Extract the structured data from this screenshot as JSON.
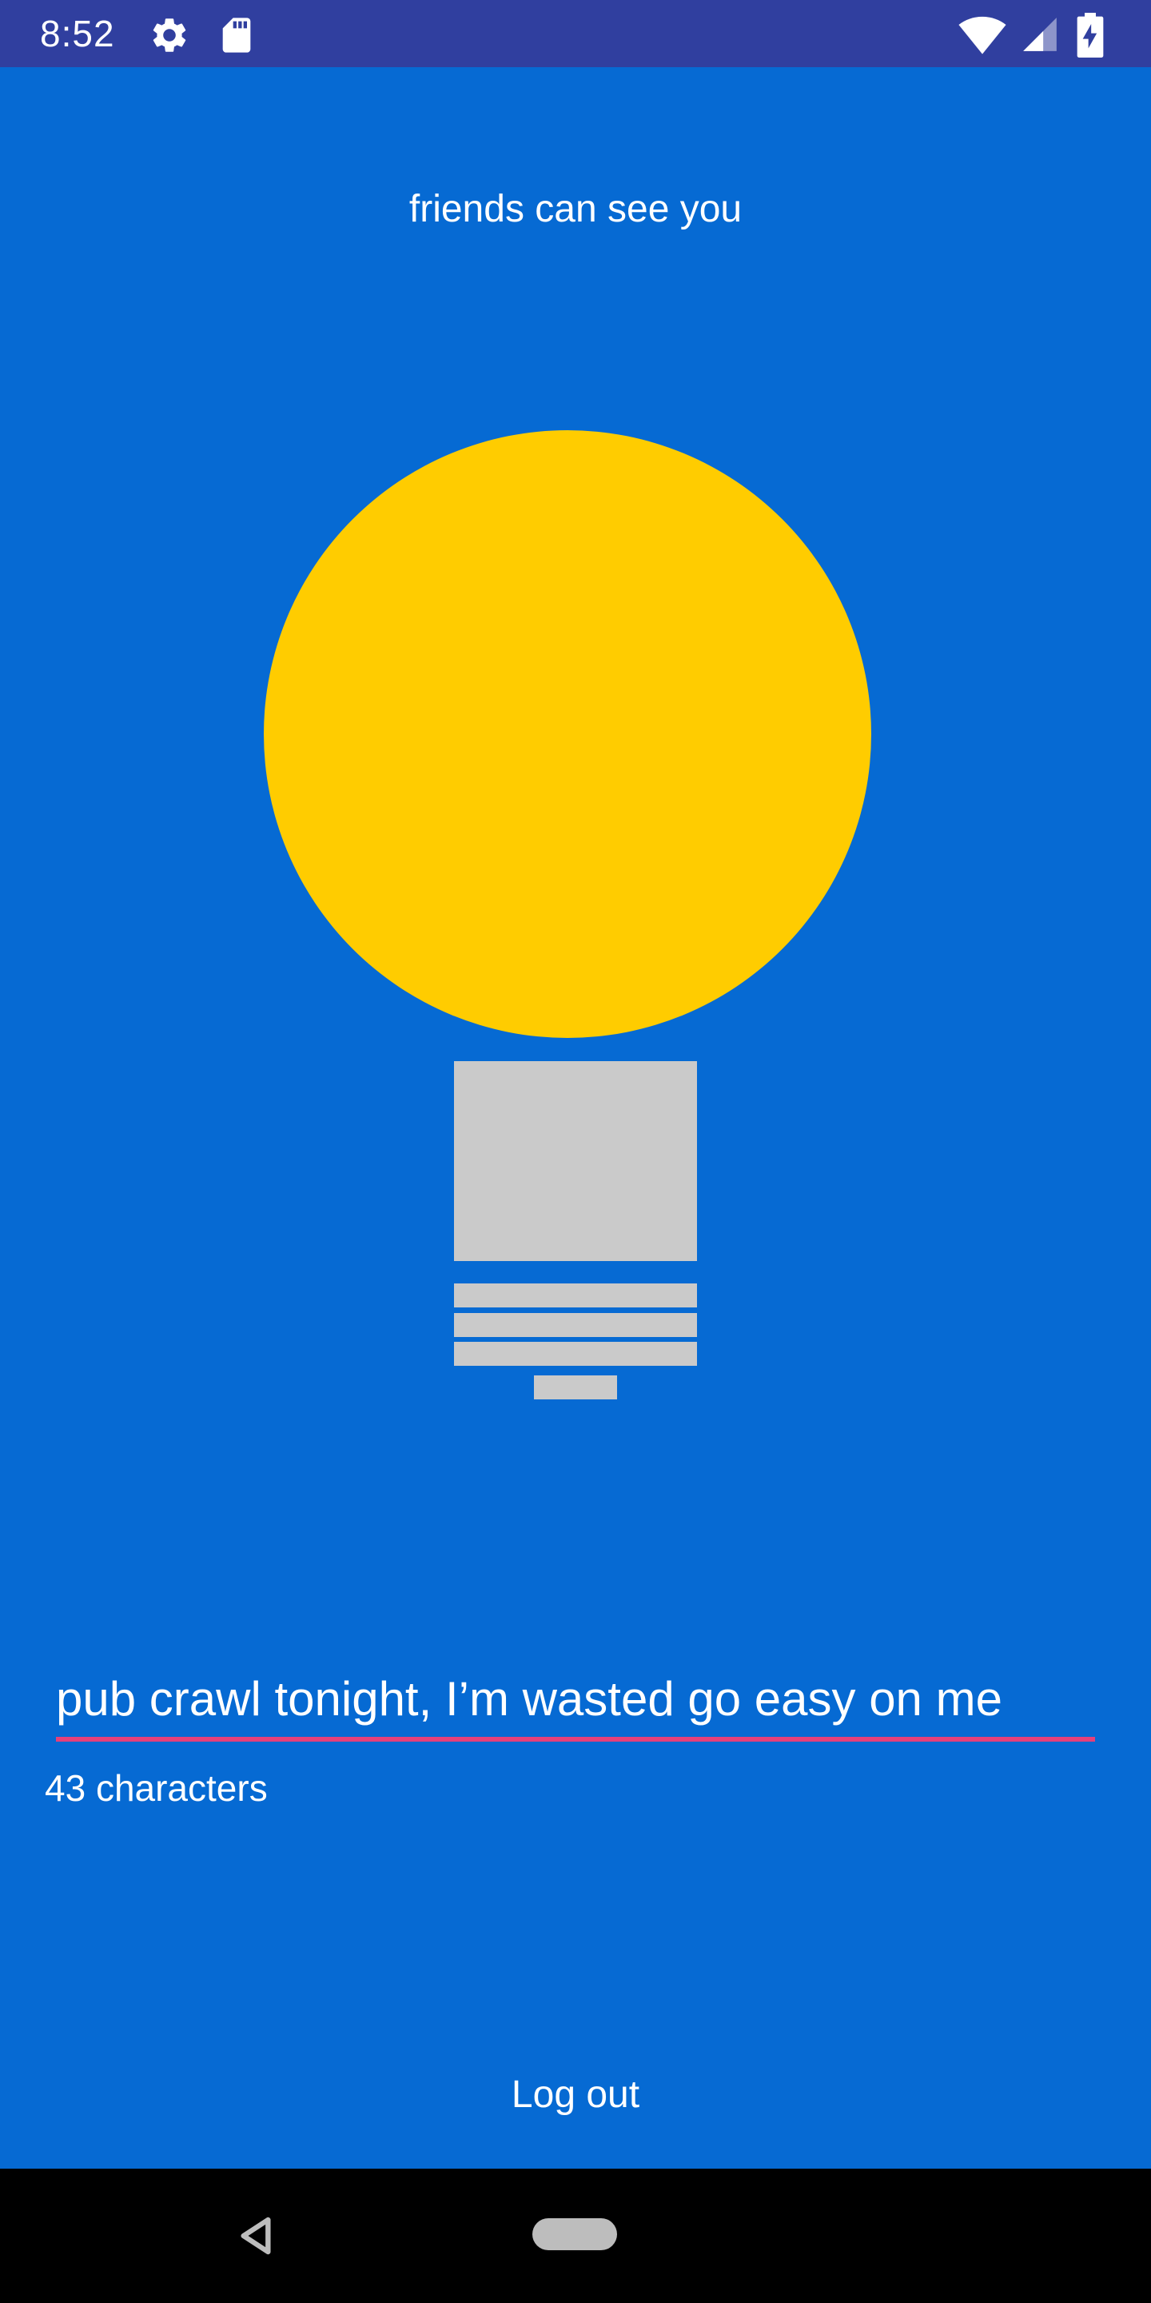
{
  "status_bar": {
    "time": "8:52",
    "icons": [
      "gear-icon",
      "sd-card-icon",
      "wifi-icon",
      "cell-signal-icon",
      "battery-charging-icon"
    ],
    "background": "#303F9F"
  },
  "main": {
    "visibility_text": "friends can see you",
    "bulb": {
      "icon": "lightbulb-icon",
      "state": "on",
      "glass_color": "#FFCC00",
      "base_color": "#CACACA"
    },
    "status_input": {
      "value": "pub crawl tonight, I’m wasted go easy on me",
      "underline_color": "#E5407A"
    },
    "char_count": "43 characters",
    "logout_label": "Log out",
    "background": "#066AD3"
  },
  "nav_bar": {
    "back": "back-icon",
    "home": "home-pill"
  }
}
